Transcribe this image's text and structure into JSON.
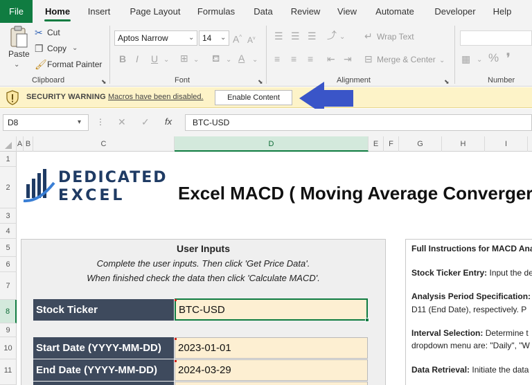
{
  "tabs": [
    "File",
    "Home",
    "Insert",
    "Page Layout",
    "Formulas",
    "Data",
    "Review",
    "View",
    "Automate",
    "Developer",
    "Help"
  ],
  "ribbon": {
    "clipboard": {
      "paste": "Paste",
      "cut": "Cut",
      "copy": "Copy",
      "format_painter": "Format Painter",
      "label": "Clipboard"
    },
    "font": {
      "name": "Aptos Narrow",
      "size": "14",
      "label": "Font"
    },
    "alignment": {
      "wrap_text": "Wrap Text",
      "merge_center": "Merge & Center",
      "label": "Alignment"
    },
    "number": {
      "label": "Number",
      "percent": "%"
    }
  },
  "security": {
    "title": "SECURITY WARNING",
    "message": "Macros have been disabled.",
    "button": "Enable Content"
  },
  "formula_bar": {
    "name_box": "D8",
    "fx": "fx",
    "value": "BTC-USD"
  },
  "columns": [
    "A",
    "B",
    "C",
    "D",
    "E",
    "F",
    "G",
    "H",
    "I"
  ],
  "rows": [
    "1",
    "2",
    "3",
    "4",
    "5",
    "6",
    "7",
    "8",
    "9",
    "10",
    "11"
  ],
  "sheet": {
    "logo_line1": "DEDICATED",
    "logo_line2": "EXCEL",
    "title": "Excel MACD ( Moving Average Converger",
    "inputs_title": "User Inputs",
    "instruction1": "Complete the user inputs.  Then click 'Get Price Data'.",
    "instruction2": "When finished check the data then click 'Calculate MACD'.",
    "fields": [
      {
        "label": "Stock Ticker",
        "value": "BTC-USD"
      },
      {
        "label": "Start Date (YYYY-MM-DD)",
        "value": "2023-01-01"
      },
      {
        "label": "End Date (YYYY-MM-DD)",
        "value": "2024-03-29"
      }
    ],
    "instructions_panel": {
      "heading": "Full Instructions for MACD Ana",
      "ticker_bold": "Stock Ticker Entry:",
      "ticker_text": " Input the de",
      "period_bold": "Analysis Period Specification:",
      "period_text": "D11 (End Date), respectively. P",
      "interval_bold": "Interval Selection:",
      "interval_text": " Determine t",
      "interval_text2": "dropdown menu are: \"Daily\", \"W",
      "retrieval_bold": "Data Retrieval:",
      "retrieval_text": " Initiate the data"
    }
  },
  "colors": {
    "accent": "#107c41",
    "label_bg": "#3e4a5d",
    "value_bg": "#fdefd2",
    "warning_bg": "#fdf3c8",
    "arrow": "#3a55c8"
  }
}
